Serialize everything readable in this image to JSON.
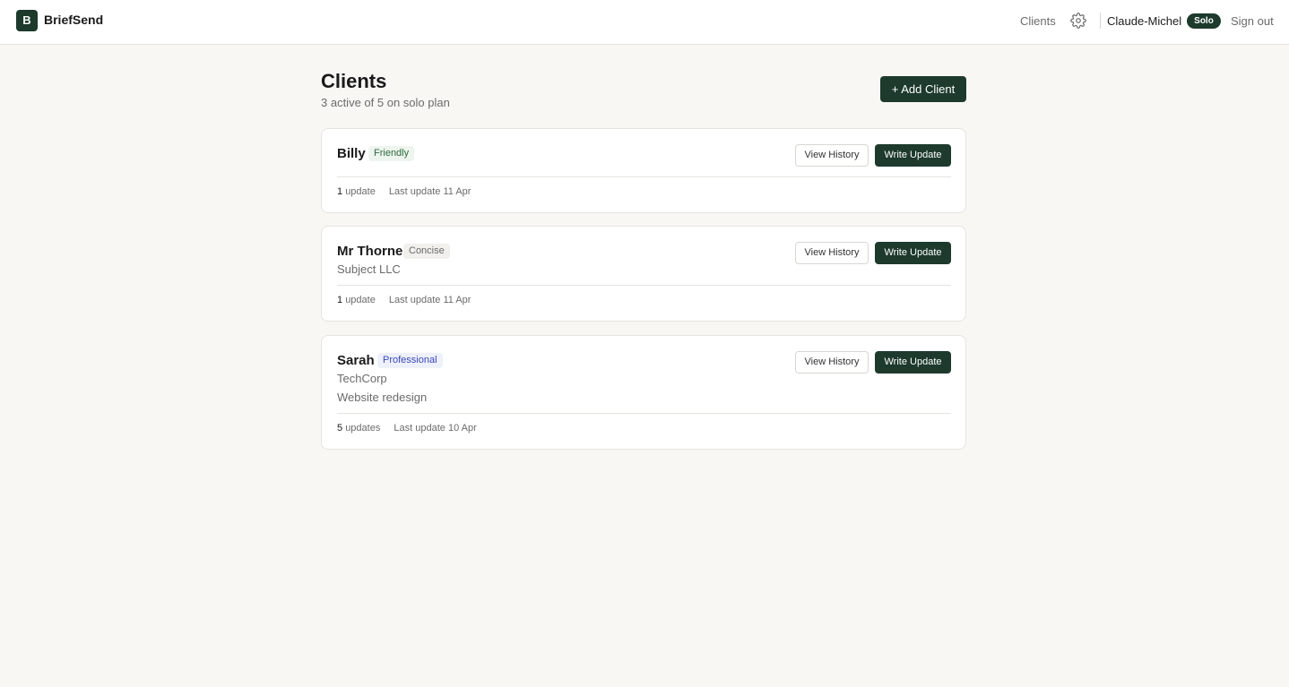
{
  "brand": {
    "logo_letter": "B",
    "name": "BriefSend"
  },
  "nav": {
    "clients_label": "Clients",
    "settings_icon": "gear-icon",
    "user_name": "Claude-Michel",
    "plan_badge": "Solo",
    "sign_out_label": "Sign out"
  },
  "page": {
    "title": "Clients",
    "subtitle": "3 active of 5 on solo plan",
    "add_client_label": "+ Add Client"
  },
  "clients": [
    {
      "name": "Billy",
      "tone": "Friendly",
      "company": "",
      "project": "",
      "update_count": "1",
      "update_word": "update",
      "last_update": "Last update 11 Apr",
      "view_history_label": "View History",
      "write_update_label": "Write Update"
    },
    {
      "name": "Mr Thorne",
      "tone": "Concise",
      "company": "Subject LLC",
      "project": "",
      "update_count": "1",
      "update_word": "update",
      "last_update": "Last update 11 Apr",
      "view_history_label": "View History",
      "write_update_label": "Write Update"
    },
    {
      "name": "Sarah",
      "tone": "Professional",
      "company": "TechCorp",
      "project": "Website redesign",
      "update_count": "5",
      "update_word": "updates",
      "last_update": "Last update 10 Apr",
      "view_history_label": "View History",
      "write_update_label": "Write Update"
    }
  ],
  "colors": {
    "brand_dark_green": "#1d3a2c",
    "page_background": "#f8f7f4",
    "tone_friendly": "#2d6a3e",
    "tone_professional": "#3848b8"
  }
}
